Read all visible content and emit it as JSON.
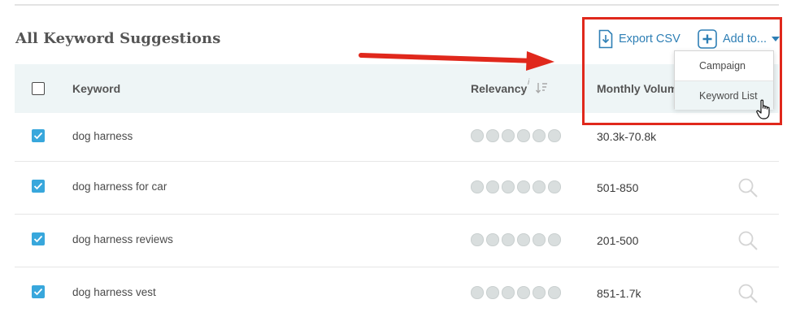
{
  "section": {
    "title": "All Keyword Suggestions"
  },
  "toolbar": {
    "export_label": "Export CSV",
    "export_icon": "file-download-icon",
    "addto_label": "Add to...",
    "addto_icon": "plus-box-icon",
    "accent_color": "#2e7fb5"
  },
  "dropdown": {
    "items": [
      {
        "label": "Campaign"
      },
      {
        "label": "Keyword List"
      }
    ]
  },
  "table": {
    "columns": {
      "keyword": "Keyword",
      "relevancy": "Relevancy",
      "relevancy_info": "i",
      "volume": "Monthly Volum"
    },
    "rows": [
      {
        "keyword": "dog harness",
        "volume": "30.3k-70.8k",
        "checked": true
      },
      {
        "keyword": "dog harness for car",
        "volume": "501-850",
        "checked": true
      },
      {
        "keyword": "dog harness reviews",
        "volume": "201-500",
        "checked": true
      },
      {
        "keyword": "dog harness vest",
        "volume": "851-1.7k",
        "checked": true
      }
    ]
  },
  "annotation": {
    "highlight_color": "#e0281c"
  }
}
